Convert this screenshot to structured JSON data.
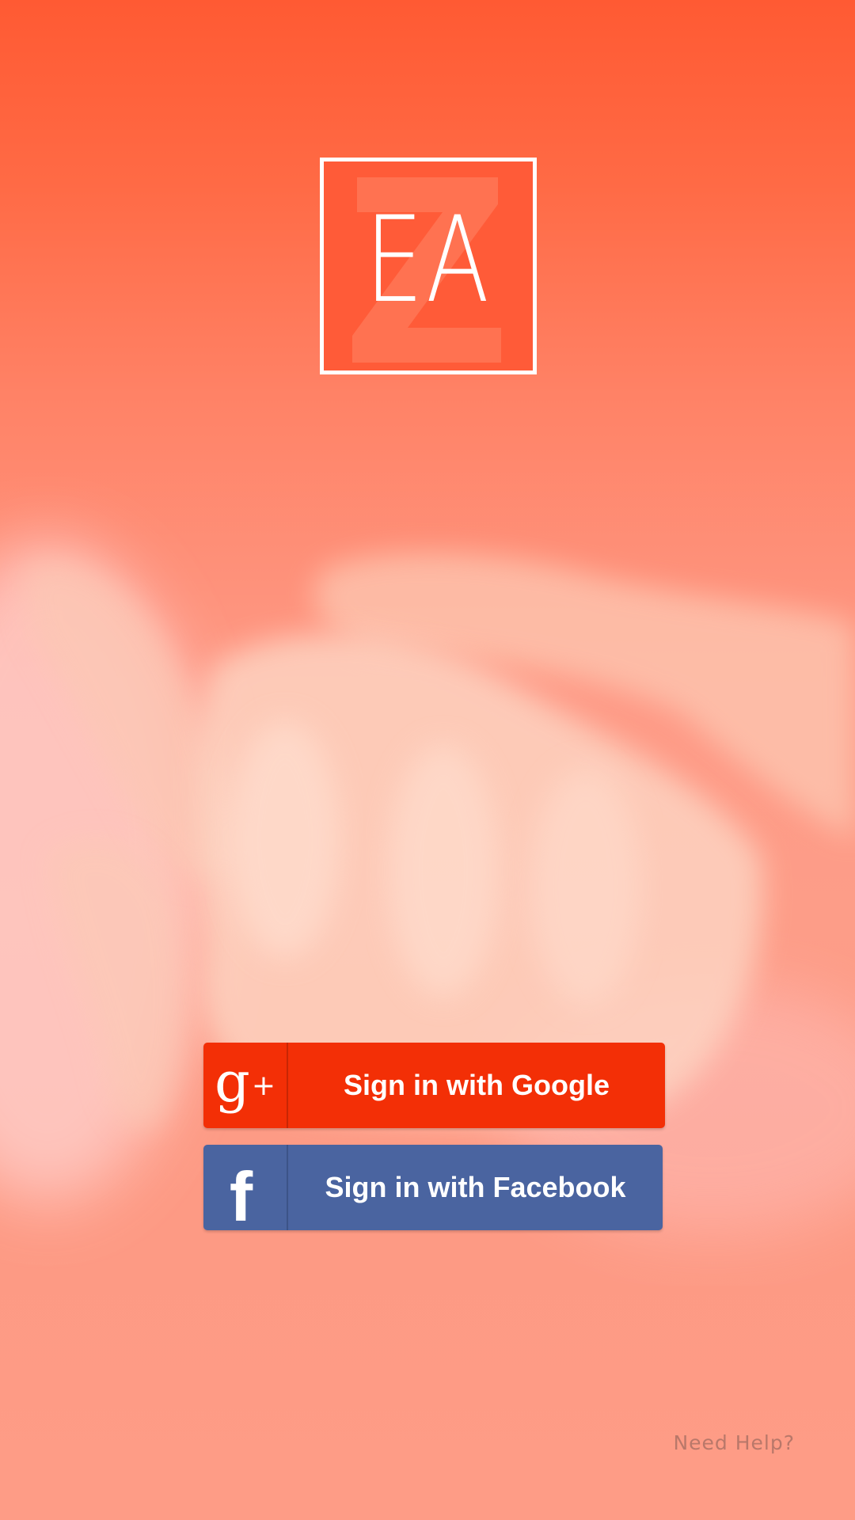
{
  "logo": {
    "letters": "EA",
    "background_letter": "Z",
    "colors": {
      "box": "#ff5b38",
      "border": "#ffffff",
      "z_letter": "#ff7a5a"
    }
  },
  "buttons": {
    "google": {
      "icon": "google-plus-icon",
      "icon_text": "g",
      "icon_plus": "+",
      "label": "Sign in with Google",
      "color": "#f32f06"
    },
    "facebook": {
      "icon": "facebook-icon",
      "icon_text": "f",
      "label": "Sign in with Facebook",
      "color": "#4a64a0"
    }
  },
  "help": {
    "label": "Need Help?"
  },
  "theme": {
    "accent": "#ff5a33"
  }
}
